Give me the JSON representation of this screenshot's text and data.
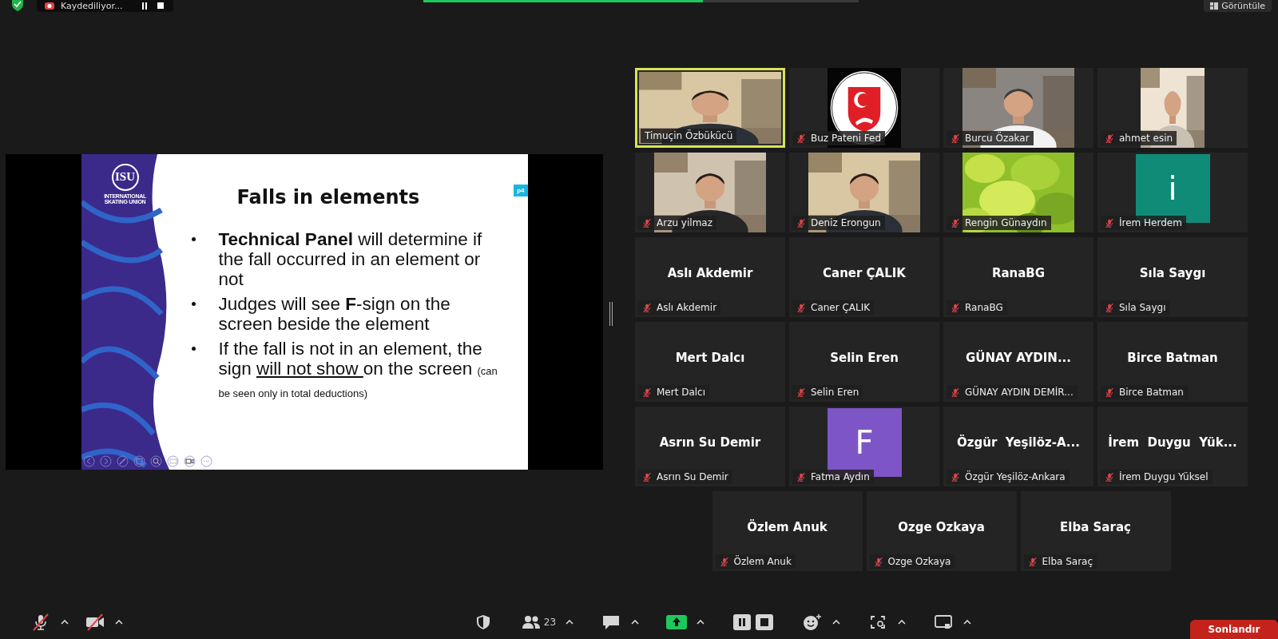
{
  "top_bar": {
    "recording_label": "Kaydediliyor...",
    "view_button": "Görüntüle"
  },
  "slide": {
    "logo": "ISU",
    "org_lines": [
      "INTERNATIONAL",
      "SKATING UNION"
    ],
    "page_badge": "p4",
    "title": "Falls in elements",
    "bullets": [
      [
        {
          "text": "Technical Panel",
          "kind": "bold"
        },
        {
          "text": " will determine if the fall occurred in an element or not",
          "kind": "plain"
        }
      ],
      [
        {
          "text": "Judges will see ",
          "kind": "plain"
        },
        {
          "text": "F",
          "kind": "bold"
        },
        {
          "text": "-sign on the screen beside the element",
          "kind": "plain"
        }
      ],
      [
        {
          "text": "If the fall is not in an element, the sign ",
          "kind": "plain"
        },
        {
          "text": "will not show ",
          "kind": "underline"
        },
        {
          "text": "on the screen ",
          "kind": "plain"
        },
        {
          "text": "(can be seen only in total deductions)",
          "kind": "small"
        }
      ]
    ]
  },
  "tiles": [
    {
      "kind": "video",
      "name": "Timuçin Özbükücü",
      "muted": false,
      "speaking": true
    },
    {
      "kind": "logo",
      "name": "Buz Pateni Fed",
      "muted": true,
      "speaking": false
    },
    {
      "kind": "video",
      "name": "Burcu Özakar",
      "muted": true,
      "speaking": false
    },
    {
      "kind": "video",
      "name": "ahmet esin",
      "muted": true,
      "speaking": false
    },
    {
      "kind": "video",
      "name": "Arzu yilmaz",
      "muted": true,
      "speaking": false
    },
    {
      "kind": "video",
      "name": "Deniz Erongun",
      "muted": true,
      "speaking": false
    },
    {
      "kind": "plants",
      "name": "Rengin Günaydın",
      "muted": true,
      "speaking": false
    },
    {
      "kind": "avatar",
      "letter": "i",
      "color": "#0f8b78",
      "name": "İrem Herdem",
      "muted": true,
      "speaking": false
    },
    {
      "kind": "name",
      "display": "Aslı Akdemir",
      "name": "Aslı Akdemir",
      "muted": true,
      "speaking": false
    },
    {
      "kind": "name",
      "display": "Caner ÇALIK",
      "name": "Caner ÇALIK",
      "muted": true,
      "speaking": false
    },
    {
      "kind": "name",
      "display": "RanaBG",
      "name": "RanaBG",
      "muted": true,
      "speaking": false
    },
    {
      "kind": "name",
      "display": "Sıla Saygı",
      "name": "Sıla Saygı",
      "muted": true,
      "speaking": false
    },
    {
      "kind": "name",
      "display": "Mert Dalcı",
      "name": "Mert Dalcı",
      "muted": true,
      "speaking": false
    },
    {
      "kind": "name",
      "display": "Selin Eren",
      "name": "Selin Eren",
      "muted": true,
      "speaking": false
    },
    {
      "kind": "name",
      "display": "GÜNAY AYDIN...",
      "name": "GÜNAY AYDIN DEMİR...",
      "muted": true,
      "speaking": false
    },
    {
      "kind": "name",
      "display": "Birce Batman",
      "name": "Birce Batman",
      "muted": true,
      "speaking": false
    },
    {
      "kind": "name",
      "display": "Asrın Su Demir",
      "name": "Asrın Su Demir",
      "muted": true,
      "speaking": false
    },
    {
      "kind": "avatar",
      "letter": "F",
      "color": "#7e55c6",
      "name": "Fatma Aydın",
      "muted": true,
      "speaking": false
    },
    {
      "kind": "name",
      "display": "Özgür  Yeşilöz-A...",
      "name": "Özgür Yeşilöz-Ankara",
      "muted": true,
      "speaking": false
    },
    {
      "kind": "name",
      "display": "İrem  Duygu  Yük...",
      "name": "İrem Duygu Yüksel",
      "muted": true,
      "speaking": false
    },
    {
      "kind": "name",
      "display": "Özlem Anuk",
      "name": "Özlem Anuk",
      "muted": true,
      "speaking": false
    },
    {
      "kind": "name",
      "display": "Ozge Ozkaya",
      "name": "Ozge Ozkaya",
      "muted": true,
      "speaking": false
    },
    {
      "kind": "name",
      "display": "Elba Saraç",
      "name": "Elba Saraç",
      "muted": true,
      "speaking": false
    }
  ],
  "toolbar": [
    {
      "kind": "mic",
      "muted": true,
      "menu": true
    },
    {
      "kind": "camera",
      "muted": true,
      "menu": true
    },
    {
      "kind": "security"
    },
    {
      "kind": "participants",
      "count": "23",
      "menu": true
    },
    {
      "kind": "chat",
      "menu": true
    },
    {
      "kind": "share",
      "menu": true
    },
    {
      "kind": "pause-stop"
    },
    {
      "kind": "reactions",
      "menu": true
    },
    {
      "kind": "apps",
      "menu": true
    },
    {
      "kind": "whiteboard",
      "menu": true
    }
  ],
  "end_button": "Sonlandır"
}
